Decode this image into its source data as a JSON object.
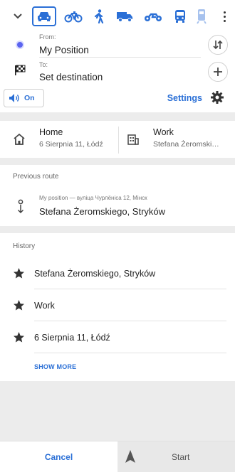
{
  "header": {
    "modes": [
      {
        "name": "car",
        "active": true
      },
      {
        "name": "bicycle",
        "active": false
      },
      {
        "name": "pedestrian",
        "active": false
      },
      {
        "name": "truck",
        "active": false
      },
      {
        "name": "motorcycle",
        "active": false
      },
      {
        "name": "public-transport",
        "active": false
      },
      {
        "name": "train",
        "active": false
      }
    ]
  },
  "route": {
    "from_label": "From:",
    "from_value": "My Position",
    "to_label": "To:",
    "to_value": "Set destination"
  },
  "options": {
    "voice_label": "On",
    "settings_label": "Settings"
  },
  "places": {
    "home_title": "Home",
    "home_address": "6 Sierpnia 11, Łódź",
    "work_title": "Work",
    "work_address": "Stefana Żeromski…"
  },
  "previous_route": {
    "title": "Previous route",
    "subtitle": "My position — вуліца Чурлёніса 12, Мінск",
    "destination": "Stefana Żeromskiego, Stryków"
  },
  "history": {
    "title": "History",
    "items": [
      {
        "label": "Stefana Żeromskiego, Stryków"
      },
      {
        "label": "Work"
      },
      {
        "label": "6 Sierpnia 11, Łódź"
      }
    ],
    "show_more_label": "SHOW MORE"
  },
  "bottom_bar": {
    "cancel_label": "Cancel",
    "start_label": "Start"
  },
  "colors": {
    "accent": "#2a6fd6",
    "my_position_dot": "#5b64f0",
    "section_background": "#ececec"
  }
}
